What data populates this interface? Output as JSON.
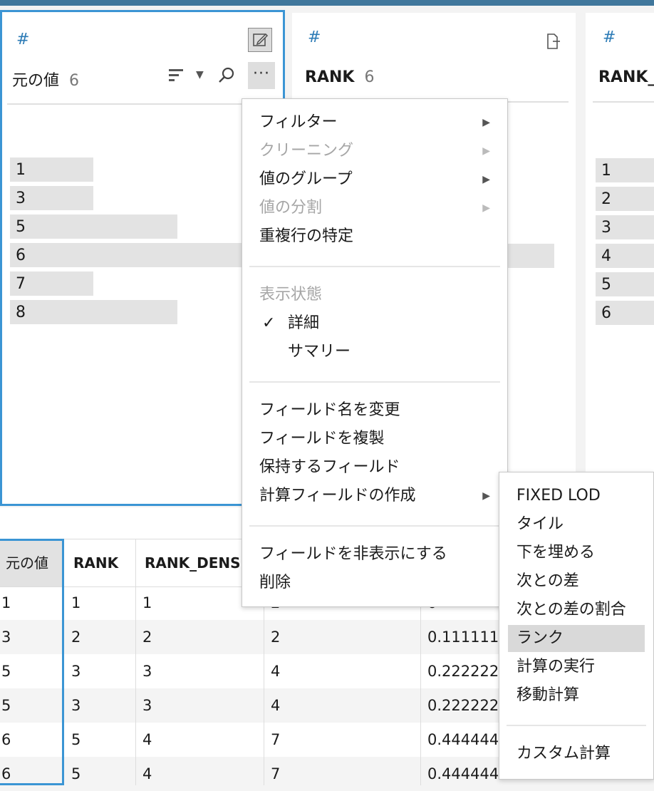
{
  "cards": [
    {
      "title": "元の値",
      "count": "6",
      "bars": [
        "1",
        "3",
        "5",
        "6",
        "7",
        "8"
      ]
    },
    {
      "title": "RANK",
      "count": "6"
    },
    {
      "title": "RANK_",
      "bars": [
        "1",
        "2",
        "3",
        "4",
        "5",
        "6"
      ]
    }
  ],
  "grid": {
    "columns": [
      "元の値",
      "RANK",
      "RANK_DENS"
    ],
    "rows": [
      [
        "1",
        "1",
        "1",
        "2",
        "0"
      ],
      [
        "3",
        "2",
        "2",
        "2",
        "0.111111"
      ],
      [
        "5",
        "3",
        "3",
        "4",
        "0.222222"
      ],
      [
        "5",
        "3",
        "3",
        "4",
        "0.222222"
      ],
      [
        "6",
        "5",
        "4",
        "7",
        "0.444444"
      ],
      [
        "6",
        "5",
        "4",
        "7",
        "0.444444"
      ]
    ]
  },
  "context_menu": {
    "group1": [
      {
        "label": "フィルター",
        "submenu": true,
        "disabled": false
      },
      {
        "label": "クリーニング",
        "submenu": true,
        "disabled": true
      },
      {
        "label": "値のグループ",
        "submenu": true,
        "disabled": false
      },
      {
        "label": "値の分割",
        "submenu": true,
        "disabled": true
      },
      {
        "label": "重複行の特定",
        "submenu": false,
        "disabled": false
      }
    ],
    "view_header": "表示状態",
    "view_detail": "詳細",
    "view_summary": "サマリー",
    "group3": [
      {
        "label": "フィールド名を変更"
      },
      {
        "label": "フィールドを複製"
      },
      {
        "label": "保持するフィールド"
      },
      {
        "label": "計算フィールドの作成",
        "submenu": true
      }
    ],
    "group4": [
      {
        "label": "フィールドを非表示にする"
      },
      {
        "label": "削除"
      }
    ]
  },
  "submenu": {
    "items": [
      "FIXED LOD",
      "タイル",
      "下を埋める",
      "次との差",
      "次との差の割合",
      "ランク",
      "計算の実行",
      "移動計算"
    ],
    "highlighted": "ランク",
    "custom": "カスタム計算"
  },
  "icons": {
    "hash": "number-type-icon",
    "arrow": "▶",
    "check": "✓"
  }
}
